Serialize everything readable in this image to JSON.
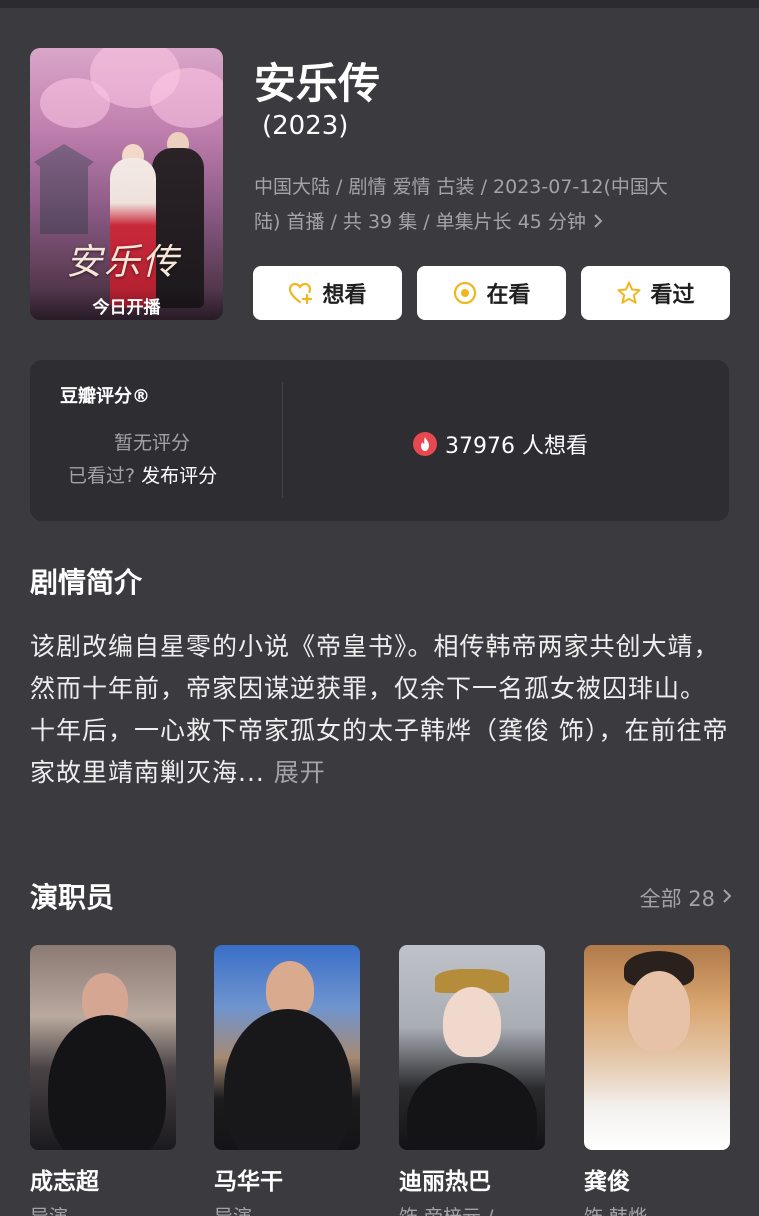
{
  "show": {
    "title": "安乐传",
    "year": "(2023)",
    "meta_line1": "中国大陆 / 剧情 爱情 古装 / 2023-07-12(中国大",
    "meta_line2": "陆) 首播 / 共 39 集 / 单集片长 45 分钟",
    "poster_logo": "安乐传",
    "poster_caption": "今日开播"
  },
  "actions": {
    "want_label": "想看",
    "watching_label": "在看",
    "watched_label": "看过"
  },
  "rating": {
    "title": "豆瓣评分®",
    "no_rating": "暂无评分",
    "watched_prompt": "已看过?",
    "publish_label": "发布评分",
    "want_count": "37976 人想看"
  },
  "synopsis": {
    "heading": "剧情简介",
    "text": "该剧改编自星零的小说《帝皇书》。相传韩帝两家共创大靖，然而十年前，帝家因谋逆获罪，仅余下一名孤女被囚琲山。十年后，一心救下帝家孤女的太子韩烨（龚俊 饰），在前往帝家故里靖南剿灭海...",
    "expand_label": " 展开"
  },
  "cast": {
    "heading": "演职员",
    "all_label": "全部 28",
    "members": [
      {
        "name": "成志超",
        "role": "导演"
      },
      {
        "name": "马华干",
        "role": "导演"
      },
      {
        "name": "迪丽热巴",
        "role": "饰 帝梓元 /"
      },
      {
        "name": "龚俊",
        "role": "饰 韩烨"
      }
    ]
  },
  "colors": {
    "background": "#3b3a3f",
    "card": "#2e2d32",
    "muted_text": "#a3a2a8",
    "accent_yellow": "#f2b61d",
    "flame_red": "#e8484f"
  }
}
